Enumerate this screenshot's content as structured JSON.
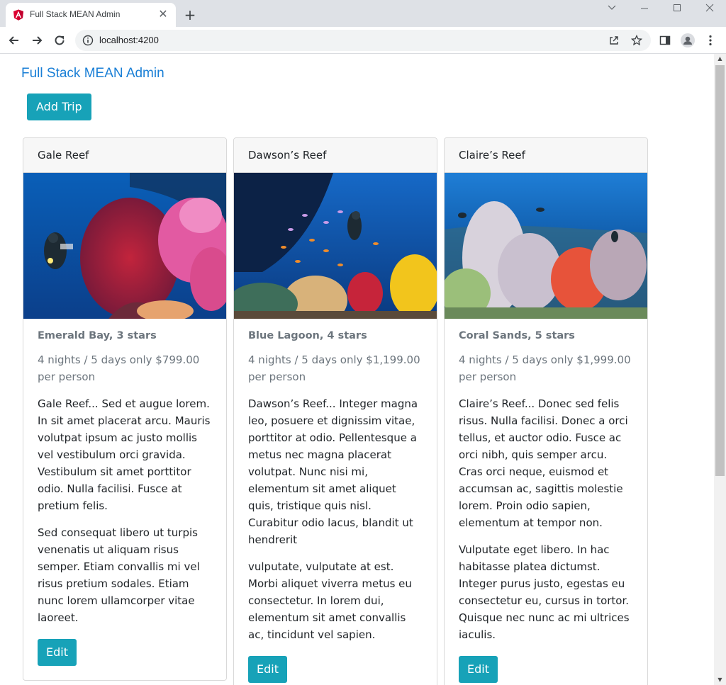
{
  "browser": {
    "tab_title": "Full Stack MEAN Admin",
    "url": "localhost:4200"
  },
  "page": {
    "brand": "Full Stack MEAN Admin",
    "add_button": "Add Trip"
  },
  "trips": [
    {
      "name": "Gale Reef",
      "title": "Emerald Bay, 3 stars",
      "subtitle": "4 nights / 5 days only $799.00 per person",
      "para1": "Gale Reef... Sed et augue lorem. In sit amet placerat arcu. Mauris volutpat ipsum ac justo mollis vel vestibulum orci gravida. Vestibulum sit amet porttitor odio. Nulla facilisi. Fusce at pretium felis.",
      "para2": "Sed consequat libero ut turpis venenatis ut aliquam risus semper. Etiam convallis mi vel risus pretium sodales. Etiam nunc lorem ullamcorper vitae laoreet.",
      "edit": "Edit"
    },
    {
      "name": "Dawson’s Reef",
      "title": "Blue Lagoon, 4 stars",
      "subtitle": "4 nights / 5 days only $1,199.00 per person",
      "para1": "Dawson’s Reef... Integer magna leo, posuere et dignissim vitae, porttitor at odio. Pellentesque a metus nec magna placerat volutpat. Nunc nisi mi, elementum sit amet aliquet quis, tristique quis nisl. Curabitur odio lacus, blandit ut hendrerit",
      "para2": "vulputate, vulputate at est. Morbi aliquet viverra metus eu consectetur. In lorem dui, elementum sit amet convallis ac, tincidunt vel sapien.",
      "edit": "Edit"
    },
    {
      "name": "Claire’s Reef",
      "title": "Coral Sands, 5 stars",
      "subtitle": "4 nights / 5 days only $1,999.00 per person",
      "para1": "Claire’s Reef... Donec sed felis risus. Nulla facilisi. Donec a orci tellus, et auctor odio. Fusce ac orci nibh, quis semper arcu. Cras orci neque, euismod et accumsan ac, sagittis molestie lorem. Proin odio sapien, elementum at tempor non.",
      "para2": "Vulputate eget libero. In hac habitasse platea dictumst. Integer purus justo, egestas eu consectetur eu, cursus in tortor. Quisque nec nunc ac mi ultrices iaculis.",
      "edit": "Edit"
    }
  ]
}
